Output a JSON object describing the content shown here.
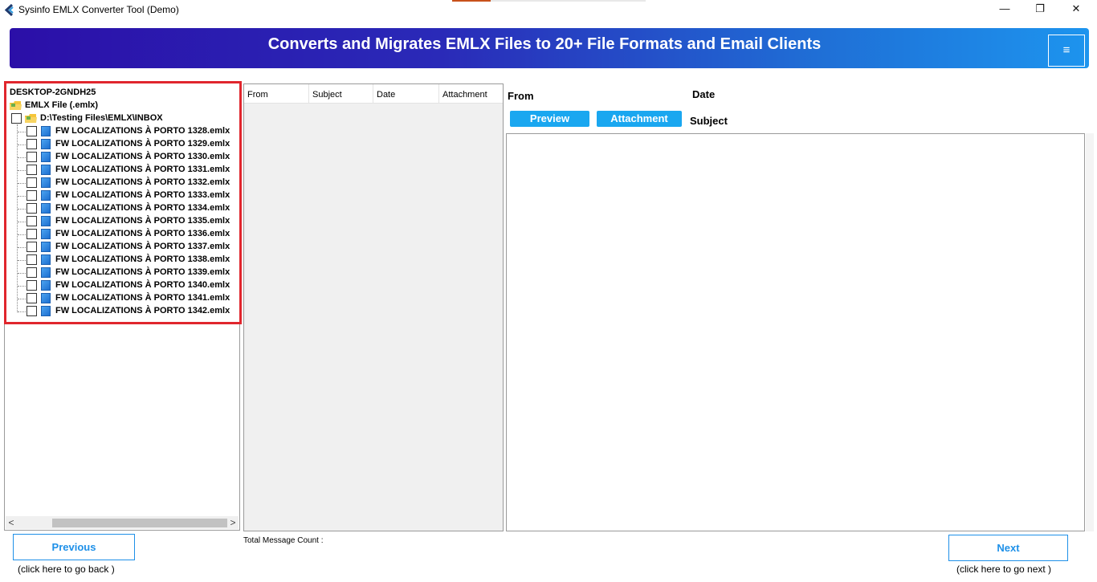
{
  "window": {
    "title": "Sysinfo EMLX Converter Tool (Demo)",
    "minimize": "—",
    "restore": "❐",
    "close": "✕"
  },
  "banner": {
    "headline": "Converts and Migrates EMLX Files to 20+ File Formats and Email Clients",
    "menu_icon": "≡"
  },
  "tree": {
    "root": "DESKTOP-2GNDH25",
    "category": "EMLX File (.emlx)",
    "folder": "D:\\Testing Files\\EMLX\\INBOX",
    "files": [
      "FW LOCALIZATIONS À PORTO  1328.emlx",
      "FW LOCALIZATIONS À PORTO  1329.emlx",
      "FW LOCALIZATIONS À PORTO  1330.emlx",
      "FW LOCALIZATIONS À PORTO  1331.emlx",
      "FW LOCALIZATIONS À PORTO  1332.emlx",
      "FW LOCALIZATIONS À PORTO  1333.emlx",
      "FW LOCALIZATIONS À PORTO  1334.emlx",
      "FW LOCALIZATIONS À PORTO  1335.emlx",
      "FW LOCALIZATIONS À PORTO  1336.emlx",
      "FW LOCALIZATIONS À PORTO  1337.emlx",
      "FW LOCALIZATIONS À PORTO  1338.emlx",
      "FW LOCALIZATIONS À PORTO  1339.emlx",
      "FW LOCALIZATIONS À PORTO  1340.emlx",
      "FW LOCALIZATIONS À PORTO  1341.emlx",
      "FW LOCALIZATIONS À PORTO  1342.emlx"
    ],
    "scroll_left": "<",
    "scroll_right": ">"
  },
  "message_list": {
    "columns": [
      "From",
      "Subject",
      "Date",
      "Attachment"
    ],
    "total_label": "Total Message Count :"
  },
  "preview": {
    "from_label": "From",
    "date_label": "Date",
    "subject_label": "Subject",
    "preview_button": "Preview",
    "attachment_button": "Attachment"
  },
  "navigation": {
    "previous": "Previous",
    "previous_hint": "(click here to  go back )",
    "next": "Next",
    "next_hint": "(click here to  go next )"
  },
  "colors": {
    "accent": "#1aa7f0",
    "highlight": "#e0262d",
    "banner_start": "#2b0fa8",
    "banner_end": "#1d94ee"
  }
}
